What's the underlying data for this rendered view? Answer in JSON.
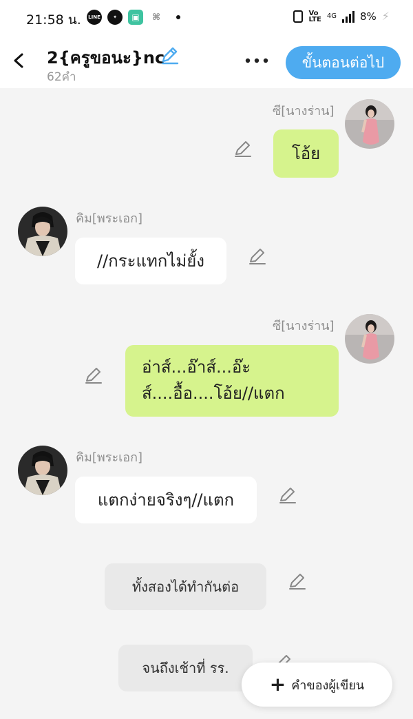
{
  "status_bar": {
    "time": "21:58 น.",
    "app_icons": [
      "line-icon",
      "messenger-icon",
      "app-icon",
      "game-icon"
    ],
    "network": "4G",
    "battery": "8%"
  },
  "header": {
    "title": "2{ครูขอนะ}nc",
    "word_count": "62คำ",
    "next_label": "ขั้นตอนต่อไป"
  },
  "messages": [
    {
      "side": "right",
      "speaker": "ซี[นางร่าน]",
      "lines": [
        "โอ้ย"
      ]
    },
    {
      "side": "left",
      "speaker": "คิม[พระเอก]",
      "lines": [
        "//กระแทกไม่ยั้ง"
      ]
    },
    {
      "side": "right",
      "speaker": "ซี[นางร่าน]",
      "lines": [
        "อ่าส์...อ๊าส์...อ๊ะ",
        "ส์....อื้อ....โอ้ย//แตก"
      ]
    },
    {
      "side": "left",
      "speaker": "คิม[พระเอก]",
      "lines": [
        "แตกง่ายจริงๆ//แตก"
      ]
    },
    {
      "side": "narration",
      "lines": [
        "ทั้งสองได้ทำกันต่อ"
      ]
    },
    {
      "side": "narration",
      "lines": [
        "จนถึงเช้าที่ รร."
      ]
    }
  ],
  "author_button": {
    "label": "คำของผู้เขียน"
  },
  "colors": {
    "accent": "#4eabf0",
    "right_bubble": "#d6f38d",
    "left_bubble": "#ffffff",
    "narration_bubble": "#e9e9e9",
    "background": "#f4f4f4"
  }
}
